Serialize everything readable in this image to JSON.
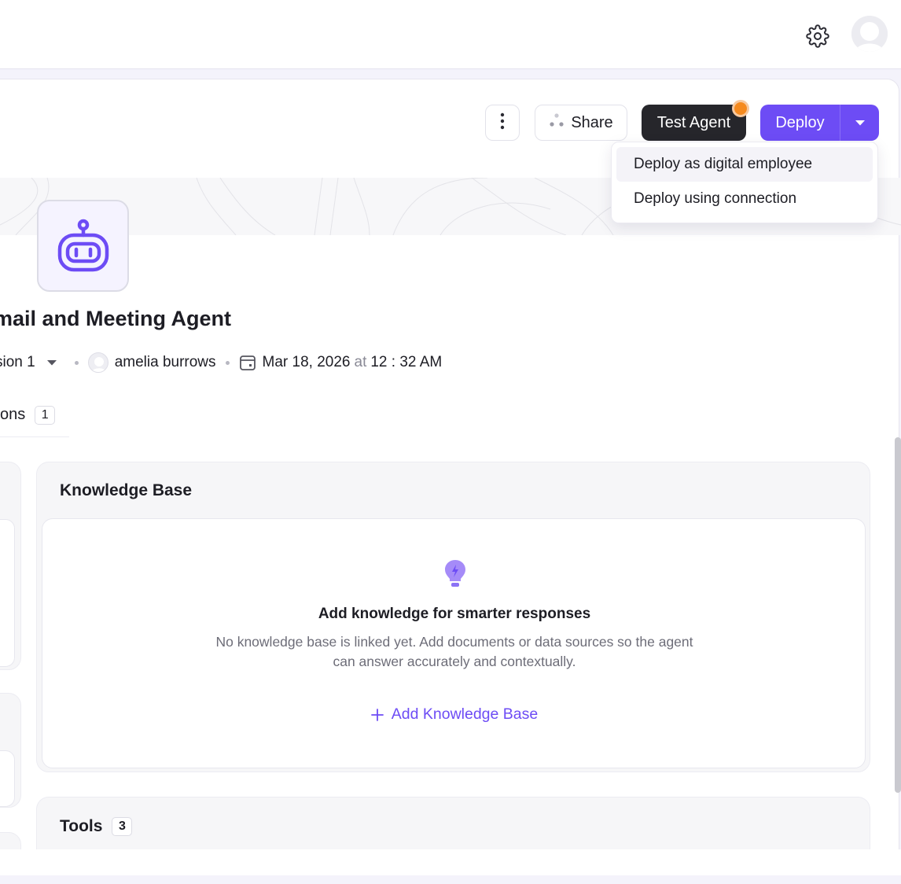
{
  "topbar": {
    "settings_icon": "gear-icon",
    "avatar_icon": "user-avatar-icon"
  },
  "toolbar": {
    "more_icon": "vertical-dots-icon",
    "share_label": "Share",
    "share_icon": "share-dots-icon",
    "test_agent_label": "Test Agent",
    "test_agent_indicator_color": "#f58a1f",
    "deploy_label": "Deploy",
    "deploy_caret_icon": "caret-down-icon",
    "accent_color": "#6d4cf5"
  },
  "deploy_menu": {
    "items": [
      {
        "label": "Deploy as digital employee",
        "active": true
      },
      {
        "label": "Deploy using connection",
        "active": false
      }
    ]
  },
  "agent": {
    "icon": "robot-icon",
    "name": "mail and Meeting Agent",
    "version_label": "sion 1",
    "author": "amelia burrows",
    "date": "Mar 18, 2026",
    "date_connector": "at",
    "time": "12 : 32 AM"
  },
  "tabs": {
    "partial_label": "ons",
    "count": "1"
  },
  "knowledge_base": {
    "title": "Knowledge Base",
    "empty_icon": "lightbulb-icon",
    "empty_heading": "Add knowledge for smarter responses",
    "empty_description_line1": "No knowledge base is linked yet. Add documents or data sources so the agent",
    "empty_description_line2": "can answer accurately and contextually.",
    "add_label": "Add Knowledge Base",
    "add_icon": "plus-icon"
  },
  "tools": {
    "title": "Tools",
    "count": "3"
  }
}
